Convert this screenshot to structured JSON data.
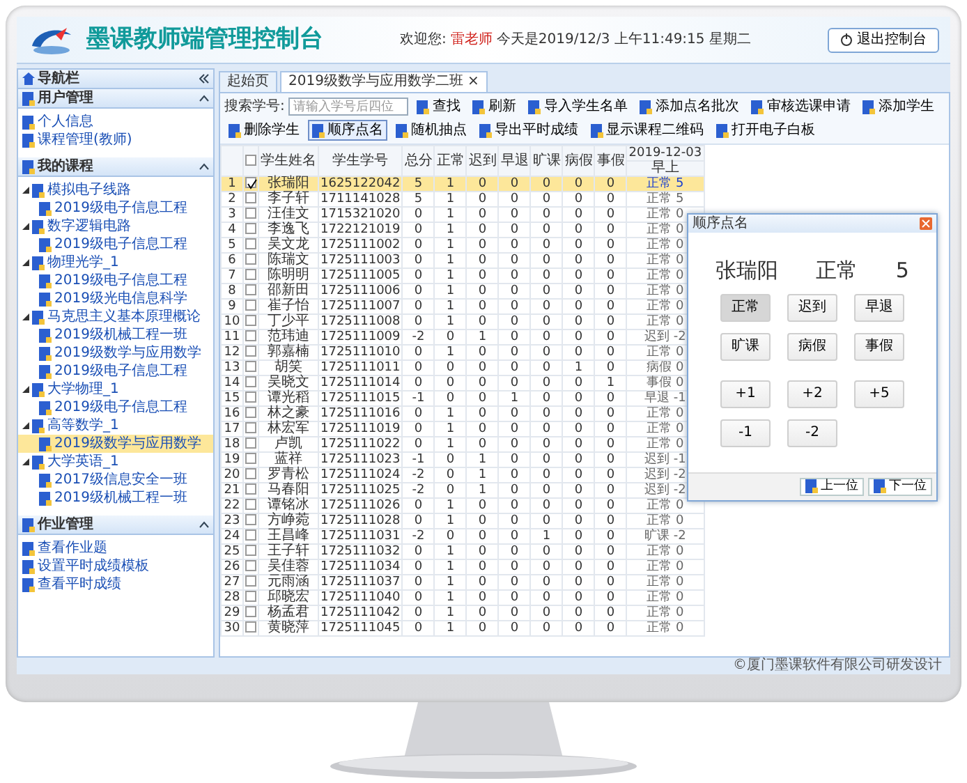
{
  "header": {
    "title": "墨课教师端管理控制台",
    "welcome": "欢迎您:",
    "user": "雷老师",
    "datetime": "今天是2019/12/3 上午11:49:15 星期二",
    "exit_button": "退出控制台"
  },
  "sidebar": {
    "nav_title": "导航栏",
    "sections": [
      {
        "title": "用户管理",
        "items": [
          {
            "label": "个人信息",
            "selected": false
          },
          {
            "label": "课程管理(教师)",
            "selected": false
          }
        ]
      },
      {
        "title": "我的课程",
        "items": [
          {
            "label": "模拟电子线路",
            "selected": false,
            "expanded": true,
            "children": [
              {
                "label": "2019级电子信息工程",
                "selected": false
              }
            ]
          },
          {
            "label": "数字逻辑电路",
            "selected": false,
            "expanded": true,
            "children": [
              {
                "label": "2019级电子信息工程",
                "selected": false
              }
            ]
          },
          {
            "label": "物理光学_1",
            "selected": false,
            "expanded": true,
            "children": [
              {
                "label": "2019级电子信息工程",
                "selected": false
              },
              {
                "label": "2019级光电信息科学",
                "selected": false
              }
            ]
          },
          {
            "label": "马克思主义基本原理概论",
            "selected": false,
            "expanded": true,
            "children": [
              {
                "label": "2019级机械工程一班",
                "selected": false
              },
              {
                "label": "2019级数学与应用数学",
                "selected": false
              },
              {
                "label": "2019级电子信息工程",
                "selected": false
              }
            ]
          },
          {
            "label": "大学物理_1",
            "selected": false,
            "expanded": true,
            "children": [
              {
                "label": "2019级电子信息工程",
                "selected": false
              }
            ]
          },
          {
            "label": "高等数学_1",
            "selected": false,
            "expanded": true,
            "children": [
              {
                "label": "2019级数学与应用数学",
                "selected": true
              }
            ]
          },
          {
            "label": "大学英语_1",
            "selected": false,
            "expanded": true,
            "children": [
              {
                "label": "2017级信息安全一班",
                "selected": false
              },
              {
                "label": "2019级机械工程一班",
                "selected": false
              }
            ]
          }
        ]
      },
      {
        "title": "作业管理",
        "items": [
          {
            "label": "查看作业题",
            "selected": false
          },
          {
            "label": "设置平时成绩模板",
            "selected": false
          },
          {
            "label": "查看平时成绩",
            "selected": false
          }
        ]
      }
    ]
  },
  "tabs": [
    {
      "label": "起始页",
      "selected": false
    },
    {
      "label": "2019级数学与应用数学二班",
      "selected": true,
      "close": "×"
    }
  ],
  "toolbar": {
    "search_label": "搜索学号:",
    "search_placeholder": "请输入学号后四位",
    "buttons": [
      {
        "label": "查找",
        "selected": false
      },
      {
        "label": "刷新",
        "selected": false
      },
      {
        "label": "导入学生名单",
        "selected": false
      },
      {
        "label": "添加点名批次",
        "selected": false
      },
      {
        "label": "审核选课申请",
        "selected": false
      },
      {
        "label": "添加学生",
        "selected": false
      },
      {
        "label": "删除学生",
        "selected": false
      },
      {
        "label": "顺序点名",
        "selected": true
      },
      {
        "label": "随机抽点",
        "selected": false
      },
      {
        "label": "导出平时成绩",
        "selected": false
      },
      {
        "label": "显示课程二维码",
        "selected": false
      },
      {
        "label": "打开电子白板",
        "selected": false
      }
    ]
  },
  "table": {
    "header_checked": false,
    "columns": [
      "学生姓名",
      "学生学号",
      "总分",
      "正常",
      "迟到",
      "早退",
      "旷课",
      "病假",
      "事假"
    ],
    "date": "2019-12-03",
    "session": "早上",
    "rows": [
      {
        "no": "1",
        "checked": true,
        "selected": true,
        "cells": [
          "张瑞阳",
          "1625122042",
          "5",
          "1",
          "0",
          "0",
          "0",
          "0",
          "0",
          "正常 5"
        ]
      },
      {
        "no": "2",
        "checked": false,
        "selected": false,
        "cells": [
          "李子轩",
          "1711141028",
          "5",
          "1",
          "0",
          "0",
          "0",
          "0",
          "0",
          "正常 5"
        ]
      },
      {
        "no": "3",
        "checked": false,
        "selected": false,
        "cells": [
          "汪佳文",
          "1715321020",
          "0",
          "1",
          "0",
          "0",
          "0",
          "0",
          "0",
          "正常 0"
        ]
      },
      {
        "no": "4",
        "checked": false,
        "selected": false,
        "cells": [
          "李逸飞",
          "1722121019",
          "0",
          "1",
          "0",
          "0",
          "0",
          "0",
          "0",
          "正常 0"
        ]
      },
      {
        "no": "5",
        "checked": false,
        "selected": false,
        "cells": [
          "吴文龙",
          "1725111002",
          "0",
          "1",
          "0",
          "0",
          "0",
          "0",
          "0",
          "正常 0"
        ]
      },
      {
        "no": "6",
        "checked": false,
        "selected": false,
        "cells": [
          "陈瑞文",
          "1725111003",
          "0",
          "1",
          "0",
          "0",
          "0",
          "0",
          "0",
          "正常 0"
        ]
      },
      {
        "no": "7",
        "checked": false,
        "selected": false,
        "cells": [
          "陈明明",
          "1725111005",
          "0",
          "1",
          "0",
          "0",
          "0",
          "0",
          "0",
          "正常 0"
        ]
      },
      {
        "no": "8",
        "checked": false,
        "selected": false,
        "cells": [
          "邵新田",
          "1725111006",
          "0",
          "1",
          "0",
          "0",
          "0",
          "0",
          "0",
          "正常 0"
        ]
      },
      {
        "no": "9",
        "checked": false,
        "selected": false,
        "cells": [
          "崔子怡",
          "1725111007",
          "0",
          "1",
          "0",
          "0",
          "0",
          "0",
          "0",
          "正常 0"
        ]
      },
      {
        "no": "10",
        "checked": false,
        "selected": false,
        "cells": [
          "丁少平",
          "1725111008",
          "0",
          "1",
          "0",
          "0",
          "0",
          "0",
          "0",
          "正常 0"
        ]
      },
      {
        "no": "11",
        "checked": false,
        "selected": false,
        "cells": [
          "范玮迪",
          "1725111009",
          "-2",
          "0",
          "1",
          "0",
          "0",
          "0",
          "0",
          "迟到 -2"
        ]
      },
      {
        "no": "12",
        "checked": false,
        "selected": false,
        "cells": [
          "郭嘉楠",
          "1725111010",
          "0",
          "1",
          "0",
          "0",
          "0",
          "0",
          "0",
          "正常 0"
        ]
      },
      {
        "no": "13",
        "checked": false,
        "selected": false,
        "cells": [
          "胡笑",
          "1725111011",
          "0",
          "0",
          "0",
          "0",
          "0",
          "1",
          "0",
          "病假 0"
        ]
      },
      {
        "no": "14",
        "checked": false,
        "selected": false,
        "cells": [
          "吴晓文",
          "1725111014",
          "0",
          "0",
          "0",
          "0",
          "0",
          "0",
          "1",
          "事假 0"
        ]
      },
      {
        "no": "15",
        "checked": false,
        "selected": false,
        "cells": [
          "谭光稻",
          "1725111015",
          "-1",
          "0",
          "0",
          "1",
          "0",
          "0",
          "0",
          "早退 -1"
        ]
      },
      {
        "no": "16",
        "checked": false,
        "selected": false,
        "cells": [
          "林之豪",
          "1725111016",
          "0",
          "1",
          "0",
          "0",
          "0",
          "0",
          "0",
          "正常 0"
        ]
      },
      {
        "no": "17",
        "checked": false,
        "selected": false,
        "cells": [
          "林宏军",
          "1725111019",
          "0",
          "1",
          "0",
          "0",
          "0",
          "0",
          "0",
          "正常 0"
        ]
      },
      {
        "no": "18",
        "checked": false,
        "selected": false,
        "cells": [
          "卢凯",
          "1725111022",
          "0",
          "1",
          "0",
          "0",
          "0",
          "0",
          "0",
          "正常 0"
        ]
      },
      {
        "no": "19",
        "checked": false,
        "selected": false,
        "cells": [
          "蓝祥",
          "1725111023",
          "-1",
          "0",
          "1",
          "0",
          "0",
          "0",
          "0",
          "迟到 -1"
        ]
      },
      {
        "no": "20",
        "checked": false,
        "selected": false,
        "cells": [
          "罗青松",
          "1725111024",
          "-2",
          "0",
          "1",
          "0",
          "0",
          "0",
          "0",
          "迟到 -2"
        ]
      },
      {
        "no": "21",
        "checked": false,
        "selected": false,
        "cells": [
          "马春阳",
          "1725111025",
          "-2",
          "0",
          "1",
          "0",
          "0",
          "0",
          "0",
          "迟到 -2"
        ]
      },
      {
        "no": "22",
        "checked": false,
        "selected": false,
        "cells": [
          "谭铭冰",
          "1725111026",
          "0",
          "1",
          "0",
          "0",
          "0",
          "0",
          "0",
          "正常 0"
        ]
      },
      {
        "no": "23",
        "checked": false,
        "selected": false,
        "cells": [
          "方峥菀",
          "1725111028",
          "0",
          "1",
          "0",
          "0",
          "0",
          "0",
          "0",
          "正常 0"
        ]
      },
      {
        "no": "24",
        "checked": false,
        "selected": false,
        "cells": [
          "王昌峰",
          "1725111031",
          "-2",
          "0",
          "0",
          "0",
          "1",
          "0",
          "0",
          "旷课 -2"
        ]
      },
      {
        "no": "25",
        "checked": false,
        "selected": false,
        "cells": [
          "王子轩",
          "1725111032",
          "0",
          "1",
          "0",
          "0",
          "0",
          "0",
          "0",
          "正常 0"
        ]
      },
      {
        "no": "26",
        "checked": false,
        "selected": false,
        "cells": [
          "吴佳蓉",
          "1725111034",
          "0",
          "1",
          "0",
          "0",
          "0",
          "0",
          "0",
          "正常 0"
        ]
      },
      {
        "no": "27",
        "checked": false,
        "selected": false,
        "cells": [
          "元雨涵",
          "1725111037",
          "0",
          "1",
          "0",
          "0",
          "0",
          "0",
          "0",
          "正常 0"
        ]
      },
      {
        "no": "28",
        "checked": false,
        "selected": false,
        "cells": [
          "邱晓宏",
          "1725111040",
          "0",
          "1",
          "0",
          "0",
          "0",
          "0",
          "0",
          "正常 0"
        ]
      },
      {
        "no": "29",
        "checked": false,
        "selected": false,
        "cells": [
          "杨孟君",
          "1725111042",
          "0",
          "1",
          "0",
          "0",
          "0",
          "0",
          "0",
          "正常 0"
        ]
      },
      {
        "no": "30",
        "checked": false,
        "selected": false,
        "cells": [
          "黄晓萍",
          "1725111045",
          "0",
          "1",
          "0",
          "0",
          "0",
          "0",
          "0",
          "正常 0"
        ]
      }
    ]
  },
  "dialog": {
    "title": "顺序点名",
    "student": "张瑞阳",
    "status": "正常",
    "score": "5",
    "status_buttons": [
      {
        "label": "正常",
        "selected": true
      },
      {
        "label": "迟到",
        "selected": false
      },
      {
        "label": "早退",
        "selected": false
      },
      {
        "label": "旷课",
        "selected": false
      },
      {
        "label": "病假",
        "selected": false
      },
      {
        "label": "事假",
        "selected": false
      }
    ],
    "score_buttons": [
      "+1",
      "+2",
      "+5",
      "-1",
      "-2"
    ],
    "nav_buttons": [
      "上一位",
      "下一位"
    ]
  },
  "footer": "©厦门墨课软件有限公司研发设计"
}
